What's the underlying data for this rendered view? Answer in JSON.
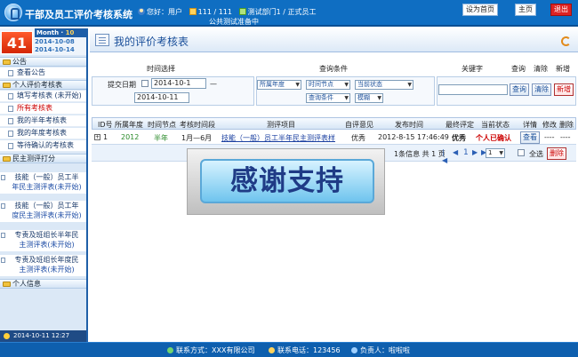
{
  "header": {
    "title": "干部及员工评价考核系统",
    "greeting": "您好：用户",
    "count": "111 / 111",
    "dept": "测试部门1 / 正式员工",
    "announcement": "公共测试准备中",
    "btn_set_home": "设为首页",
    "btn_homepage": "主页",
    "btn_logout": "退出"
  },
  "calendar": {
    "day": "41",
    "month_label": "Month · ",
    "month_value": "10",
    "date1": "2014-10-08",
    "date2": "2014-10-14"
  },
  "sidebar": {
    "sections": {
      "notice": "公告",
      "personal": "个人评价考核表",
      "democratic": "民主测评打分",
      "info": "个人信息"
    },
    "notice_items": [
      "查看公告"
    ],
    "personal_items": [
      "填写考核表 (未开始)",
      "所有考核表",
      "我的半年考核表",
      "我的年度考核表",
      "等待确认的考核表"
    ],
    "democratic_items": [
      {
        "line1": "技能（一般）员工半",
        "line2": "年民主测评表(未开始)"
      },
      {
        "line1": "技能（一般）员工年",
        "line2": "度民主测评表(未开始)"
      },
      {
        "line1": "专责及班组长半年民",
        "line2": "主测评表(未开始)"
      },
      {
        "line1": "专责及班组长年度民",
        "line2": "主测评表(未开始)"
      }
    ],
    "clock": "2014-10-11 12:27"
  },
  "main": {
    "page_title": "我的评价考核表",
    "search": {
      "col_time": "时间选择",
      "col_conditions": "查询条件",
      "col_keyword": "关键字",
      "col_query": "查询",
      "col_clear": "清除",
      "col_add": "新增",
      "submit_date_label": "提交日期",
      "date_from": "2014-10-1",
      "date_to": "2014-10-11",
      "date_sep": "—",
      "select_year": "所属年度",
      "select_node": "时间节点",
      "select_status": "当前状态",
      "select_condition": "查询条件",
      "select_fuzzy": "模糊",
      "btn_query": "查询",
      "btn_clear": "清除",
      "btn_add": "新增"
    },
    "table": {
      "headers": [
        "ID号",
        "所属年度",
        "时间节点",
        "考核时间段",
        "测评项目",
        "自评意见",
        "发布时间",
        "最终评定",
        "当前状态",
        "详情",
        "修改",
        "删除"
      ],
      "rows": [
        {
          "id": "1",
          "year": "2012",
          "node": "半年",
          "period": "1月—6月",
          "project": "技能（一般）员工半年民主测评表样",
          "self_opinion": "优秀",
          "publish_time": "2012-8-15 17:46:49",
          "final_rating": "优秀",
          "status": "个人已确认",
          "detail": "查看",
          "edit": "----",
          "delete": "----"
        }
      ]
    },
    "pager": {
      "info": "1条信息  共 1 页",
      "current": "1",
      "select_value": "1",
      "select_all": "全选",
      "btn_delete": "删除"
    },
    "banner_text": "感谢支持"
  },
  "footer": {
    "contact": "联系方式：XXX有限公司",
    "phone": "联系电话：123456",
    "owner": "负责人：啦啦啦"
  }
}
